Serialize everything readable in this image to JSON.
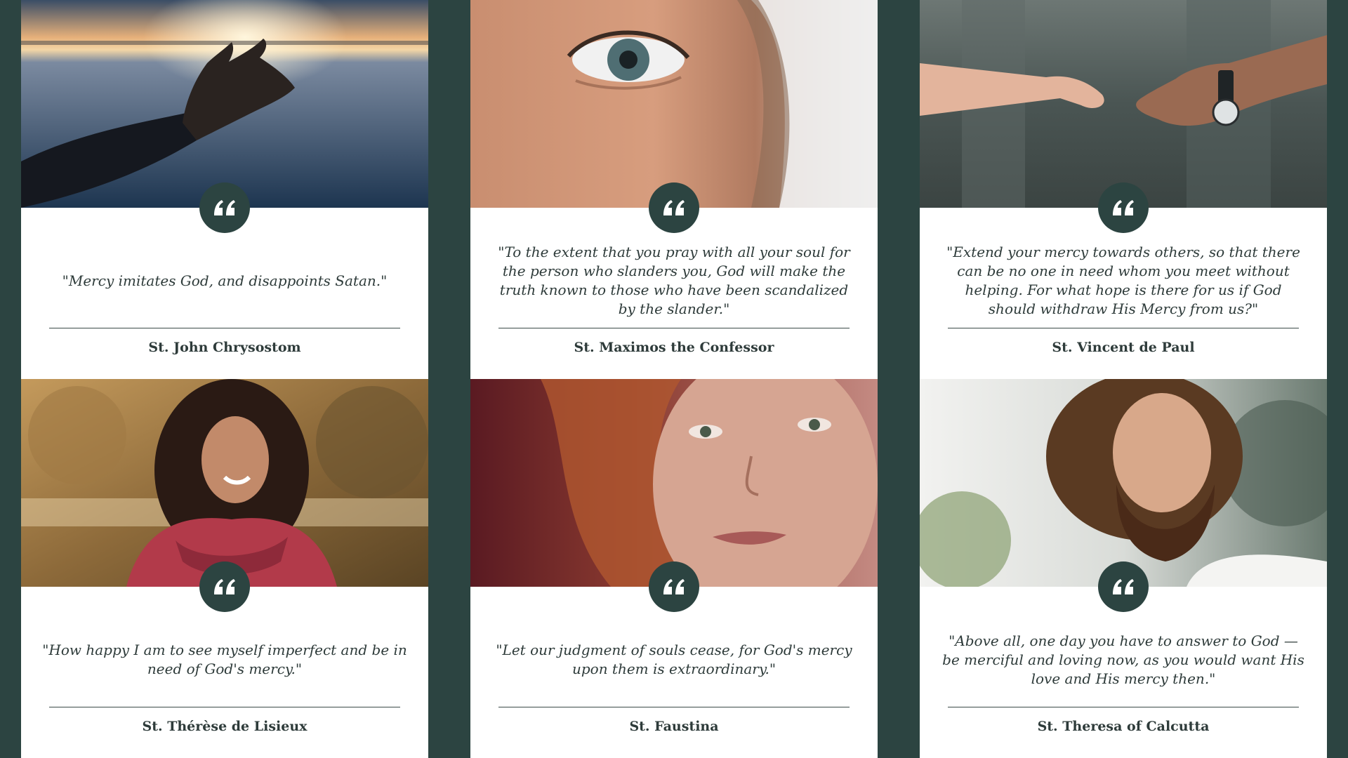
{
  "cards": [
    {
      "photo": "hand-reaching-sunset",
      "quote": "\"Mercy imitates God, and disappoints Satan.\"",
      "author": "St. John Chrysostom"
    },
    {
      "photo": "close-up-eye",
      "quote": "\"To the extent that you pray with all your soul for the person who slanders you, God will make the truth known to those who have been scandalized by the slander.\"",
      "author": "St. Maximos the Confessor"
    },
    {
      "photo": "holding-hands",
      "quote": "\"Extend your mercy towards others, so that there can be no one in need whom you meet without helping. For what hope is there for us if God should withdraw His Mercy from us?\"",
      "author": "St. Vincent de Paul"
    },
    {
      "photo": "smiling-woman-curly-hair",
      "quote": "\"How happy I am to see myself imperfect and be in need of God's mercy.\"",
      "author": "St. Thérèse de Lisieux"
    },
    {
      "photo": "woman-face-closeup",
      "quote": "\"Let our judgment of souls cease, for God's mercy upon them is extraordinary.\"",
      "author": "St. Faustina"
    },
    {
      "photo": "bearded-man-looking-up",
      "quote": "\"Above all, one day you have to answer to God — be merciful and loving now, as you would want His love and His mercy then.\"",
      "author": "St. Theresa of Calcutta"
    }
  ],
  "colors": {
    "background": "#2c4441",
    "card": "#ffffff",
    "badge": "#2c4441",
    "text": "#2e3b3a"
  },
  "icons": {
    "quote_badge": "quote-icon"
  }
}
